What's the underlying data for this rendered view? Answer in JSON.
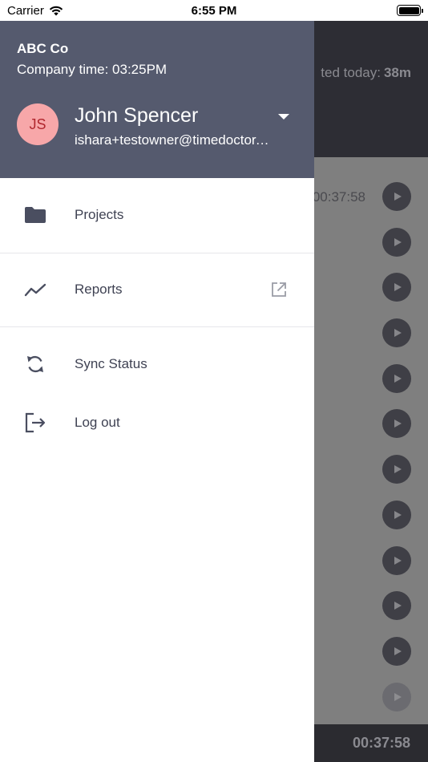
{
  "status_bar": {
    "carrier": "Carrier",
    "time": "6:55 PM"
  },
  "background": {
    "tracked_label": "ted today:",
    "tracked_value": "38m",
    "row_time": "00:37:58",
    "footer_time": "00:37:58"
  },
  "drawer": {
    "company_name": "ABC Co",
    "company_time": "Company time: 03:25PM",
    "avatar_initials": "JS",
    "user_name": "John Spencer",
    "user_email": "ishara+testowner@timedoctor.com",
    "menu": [
      {
        "label": "Projects",
        "icon": "folder-icon"
      },
      {
        "label": "Reports",
        "icon": "trending-line-icon"
      },
      {
        "label": "Sync Status",
        "icon": "sync-icon"
      },
      {
        "label": "Log out",
        "icon": "logout-icon"
      }
    ]
  },
  "colors": {
    "drawer_header": "#555a6e",
    "avatar_bg": "#f7a7a9",
    "avatar_text": "#b0272e",
    "menu_text": "#3f4253",
    "overlay": "#7f7f7f"
  }
}
